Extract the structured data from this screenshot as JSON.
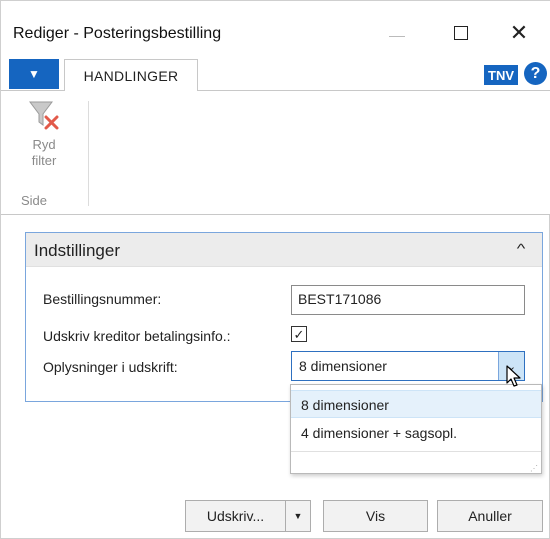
{
  "window": {
    "title": "Rediger - Posteringsbestilling",
    "close_glyph": "✕"
  },
  "ribbon": {
    "tab_label": "HANDLINGER",
    "company_badge": "TNV",
    "help_glyph": "?",
    "actions": [
      {
        "label_line1": "Ryd",
        "label_line2": "filter",
        "icon": "clear-filter-icon"
      }
    ],
    "group_label": "Side"
  },
  "fasttab": {
    "title": "Indstillinger",
    "collapse_glyph": "^"
  },
  "fields": {
    "order_number": {
      "label": "Bestillingsnummer:",
      "value": "BEST171086"
    },
    "print_vendor_payment_info": {
      "label": "Udskriv kreditor betalingsinfo.:",
      "checked": true,
      "check_glyph": "✓"
    },
    "print_details": {
      "label": "Oplysninger i udskrift:",
      "value": "8 dimensioner"
    }
  },
  "dropdown": {
    "options": [
      "8 dimensioner",
      "4 dimensioner + sagsopl."
    ],
    "selected_index": 0,
    "grip_glyph": "⋰"
  },
  "buttons": {
    "print": "Udskriv...",
    "print_arrow": "▼",
    "preview": "Vis",
    "cancel": "Anuller"
  },
  "colors": {
    "accent": "#1565c0",
    "focus_border": "#2e70c0",
    "dropdown_highlight": "#e5f1fb"
  }
}
